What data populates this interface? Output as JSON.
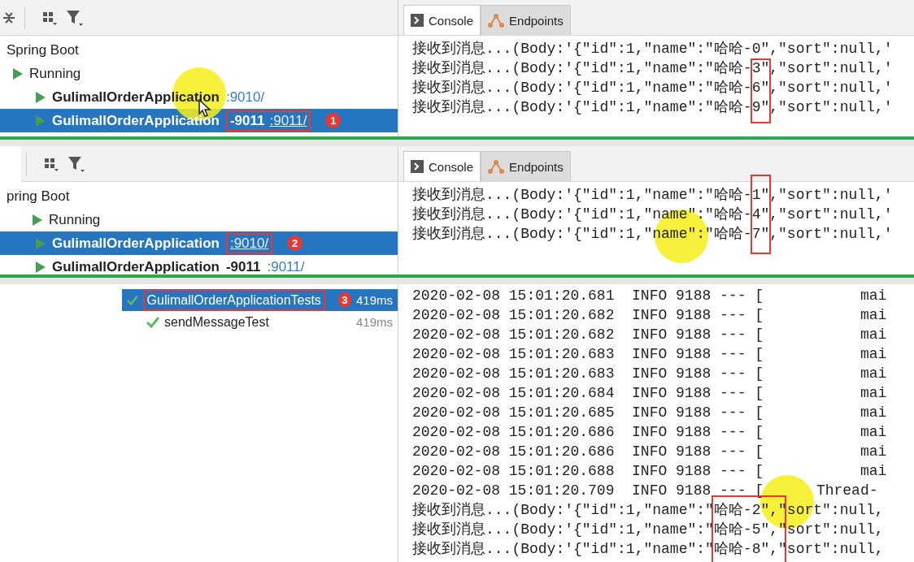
{
  "sections": [
    {
      "kind": "run",
      "tabs": [
        {
          "label": "Console",
          "selected": true
        },
        {
          "label": "Endpoints",
          "selected": false
        }
      ],
      "tree": {
        "label": "Spring Boot",
        "group": "Running",
        "apps": [
          {
            "name": "GulimallOrderApplication",
            "port": ":9010/",
            "selected": false
          },
          {
            "name": "GulimallOrderApplication",
            "suffix": "-9011",
            "port": ":9011/",
            "selected": true,
            "callout": "1"
          }
        ]
      },
      "console": [
        "接收到消息...(Body:'{\"id\":1,\"name\":\"哈哈-0\",\"sort\":null,'",
        "接收到消息...(Body:'{\"id\":1,\"name\":\"哈哈-3\",\"sort\":null,'",
        "接收到消息...(Body:'{\"id\":1,\"name\":\"哈哈-6\",\"sort\":null,'",
        "接收到消息...(Body:'{\"id\":1,\"name\":\"哈哈-9\",\"sort\":null,'"
      ]
    },
    {
      "kind": "run",
      "tabs": [
        {
          "label": "Console",
          "selected": true
        },
        {
          "label": "Endpoints",
          "selected": false
        }
      ],
      "tree": {
        "label": "pring Boot",
        "group": "Running",
        "apps": [
          {
            "name": "GulimallOrderApplication",
            "port": ":9010/",
            "selected": true,
            "callout": "2"
          },
          {
            "name": "GulimallOrderApplication",
            "suffix": "-9011",
            "port": ":9011/",
            "selected": false
          }
        ]
      },
      "console": [
        "接收到消息...(Body:'{\"id\":1,\"name\":\"哈哈-1\",\"sort\":null,'",
        "接收到消息...(Body:'{\"id\":1,\"name\":\"哈哈-4\",\"sort\":null,'",
        "接收到消息...(Body:'{\"id\":1,\"name\":\"哈哈-7\",\"sort\":null,'"
      ]
    },
    {
      "kind": "test",
      "tests": [
        {
          "name": "GulimallOrderApplicationTests",
          "time": "419ms",
          "selected": true,
          "callout": "3",
          "children": [
            {
              "name": "sendMessageTest",
              "time": "419ms",
              "selected": false
            }
          ]
        }
      ],
      "console": [
        "2020-02-08 15:01:20.681  INFO 9188 --- [           mai",
        "2020-02-08 15:01:20.682  INFO 9188 --- [           mai",
        "2020-02-08 15:01:20.682  INFO 9188 --- [           mai",
        "2020-02-08 15:01:20.683  INFO 9188 --- [           mai",
        "2020-02-08 15:01:20.683  INFO 9188 --- [           mai",
        "2020-02-08 15:01:20.684  INFO 9188 --- [           mai",
        "2020-02-08 15:01:20.685  INFO 9188 --- [           mai",
        "2020-02-08 15:01:20.686  INFO 9188 --- [           mai",
        "2020-02-08 15:01:20.686  INFO 9188 --- [           mai",
        "2020-02-08 15:01:20.688  INFO 9188 --- [           mai",
        "2020-02-08 15:01:20.709  INFO 9188 --- [      Thread-",
        "接收到消息...(Body:'{\"id\":1,\"name\":\"哈哈-2\",\"sort\":null,",
        "接收到消息...(Body:'{\"id\":1,\"name\":\"哈哈-5\",\"sort\":null,",
        "接收到消息...(Body:'{\"id\":1,\"name\":\"哈哈-8\",\"sort\":null,"
      ]
    }
  ]
}
